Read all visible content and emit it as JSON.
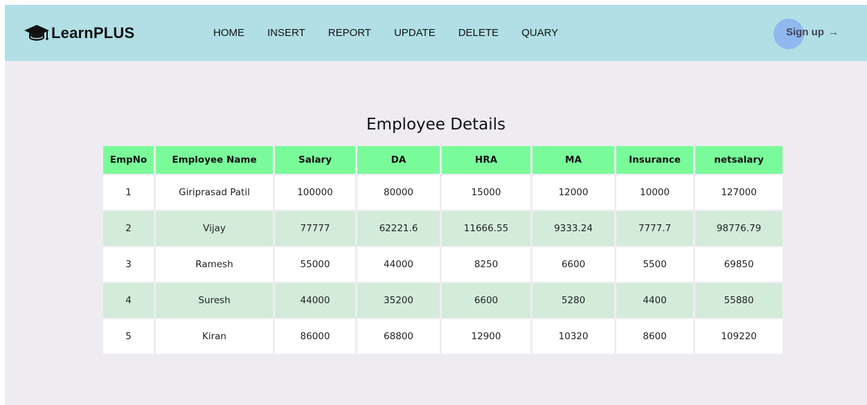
{
  "app": {
    "brand": "LearnPLUS"
  },
  "nav": {
    "links": [
      "HOME",
      "INSERT",
      "REPORT",
      "UPDATE",
      "DELETE",
      "QUARY"
    ],
    "signup_label": "Sign up",
    "signup_arrow": "→"
  },
  "page": {
    "title": "Employee Details"
  },
  "table": {
    "headers": [
      "EmpNo",
      "Employee Name",
      "Salary",
      "DA",
      "HRA",
      "MA",
      "Insurance",
      "netsalary"
    ],
    "rows": [
      [
        "1",
        "Giriprasad Patil",
        "100000",
        "80000",
        "15000",
        "12000",
        "10000",
        "127000"
      ],
      [
        "2",
        "Vijay",
        "77777",
        "62221.6",
        "11666.55",
        "9333.24",
        "7777.7",
        "98776.79"
      ],
      [
        "3",
        "Ramesh",
        "55000",
        "44000",
        "8250",
        "6600",
        "5500",
        "69850"
      ],
      [
        "4",
        "Suresh",
        "44000",
        "35200",
        "6600",
        "5280",
        "4400",
        "55880"
      ],
      [
        "5",
        "Kiran",
        "86000",
        "68800",
        "12900",
        "10320",
        "8600",
        "109220"
      ]
    ]
  },
  "colors": {
    "navbar": "#b1dfe5",
    "background": "#efecf1",
    "header_row": "#7afb9a",
    "row_alt": "#d3ecda",
    "signup_circle": "#90b8ee"
  }
}
